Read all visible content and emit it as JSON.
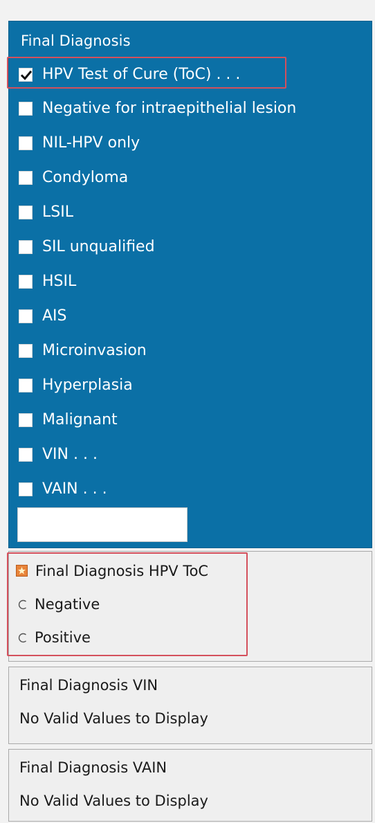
{
  "final_diagnosis": {
    "title": "Final Diagnosis",
    "options": [
      {
        "label": "HPV Test of Cure (ToC) . . .",
        "checked": true
      },
      {
        "label": "Negative for intraepithelial lesion",
        "checked": false
      },
      {
        "label": "NIL-HPV only",
        "checked": false
      },
      {
        "label": "Condyloma",
        "checked": false
      },
      {
        "label": "LSIL",
        "checked": false
      },
      {
        "label": "SIL unqualified",
        "checked": false
      },
      {
        "label": "HSIL",
        "checked": false
      },
      {
        "label": "AIS",
        "checked": false
      },
      {
        "label": "Microinvasion",
        "checked": false
      },
      {
        "label": "Hyperplasia",
        "checked": false
      },
      {
        "label": "Malignant",
        "checked": false
      },
      {
        "label": "VIN . . .",
        "checked": false
      },
      {
        "label": "VAIN . . .",
        "checked": false
      }
    ],
    "free_text_value": ""
  },
  "hpv_toc": {
    "title": "Final Diagnosis HPV ToC",
    "required_icon": "required-star-icon",
    "options": [
      {
        "label": "Negative",
        "selected": false
      },
      {
        "label": "Positive",
        "selected": false
      }
    ]
  },
  "vin": {
    "title": "Final Diagnosis VIN",
    "message": "No Valid Values to Display"
  },
  "vain": {
    "title": "Final Diagnosis VAIN",
    "message": "No Valid Values to Display"
  },
  "colors": {
    "panel_blue": "#0b70a6",
    "highlight_red": "#d4505c",
    "required_orange": "#e8843a"
  }
}
